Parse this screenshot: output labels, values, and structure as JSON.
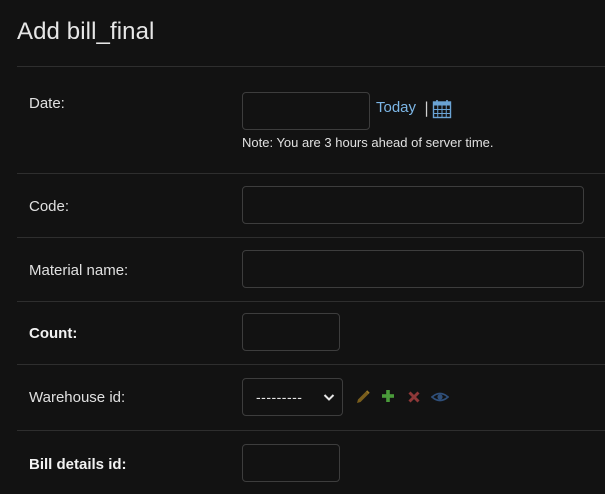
{
  "page": {
    "title": "Add bill_final"
  },
  "form": {
    "date": {
      "label": "Date:",
      "value": "",
      "today_link": "Today",
      "separator": "|",
      "calendar_icon": "calendar-icon",
      "note": "Note: You are 3 hours ahead of server time."
    },
    "code": {
      "label": "Code:",
      "value": ""
    },
    "material_name": {
      "label": "Material name:",
      "value": ""
    },
    "count": {
      "label": "Count:",
      "value": "",
      "required": true
    },
    "warehouse_id": {
      "label": "Warehouse id:",
      "selected": "---------",
      "actions": [
        "edit-pencil-icon",
        "add-plus-icon",
        "delete-x-icon",
        "view-eye-icon"
      ]
    },
    "bill_details_id": {
      "label": "Bill details id:",
      "value": "",
      "required": true
    }
  },
  "colors": {
    "background": "#121212",
    "link": "#7cb6e6",
    "edit": "#8a6a1e",
    "add": "#4a9b3a",
    "delete": "#9b3a3a",
    "view": "#2f4f7a"
  }
}
